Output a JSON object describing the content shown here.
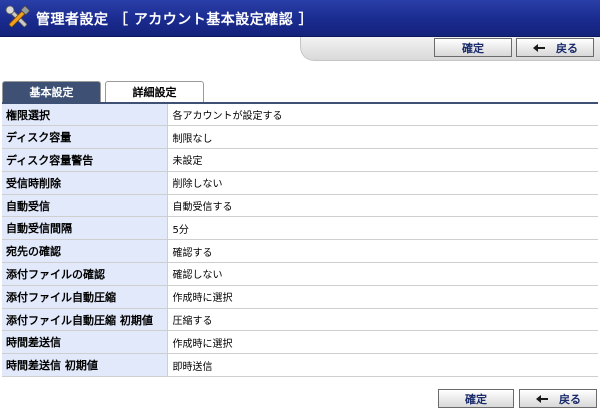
{
  "header": {
    "title": "管理者設定 ［ アカウント基本設定確認 ］",
    "icon": "tools-icon",
    "bar_color": "#1a2b8f"
  },
  "buttons": {
    "confirm": "確定",
    "back": "戻る",
    "back_icon": "back-arrow-icon"
  },
  "tabs": [
    {
      "label": "基本設定",
      "active": true
    },
    {
      "label": "詳細設定",
      "active": false
    }
  ],
  "settings": [
    {
      "label": "権限選択",
      "value": "各アカウントが設定する"
    },
    {
      "label": "ディスク容量",
      "value": "制限なし"
    },
    {
      "label": "ディスク容量警告",
      "value": "未設定"
    },
    {
      "label": "受信時削除",
      "value": "削除しない"
    },
    {
      "label": "自動受信",
      "value": "自動受信する"
    },
    {
      "label": "自動受信間隔",
      "value": "5分"
    },
    {
      "label": "宛先の確認",
      "value": "確認する"
    },
    {
      "label": "添付ファイルの確認",
      "value": "確認しない"
    },
    {
      "label": "添付ファイル自動圧縮",
      "value": "作成時に選択"
    },
    {
      "label": "添付ファイル自動圧縮 初期値",
      "value": "圧縮する"
    },
    {
      "label": "時間差送信",
      "value": "作成時に選択"
    },
    {
      "label": "時間差送信 初期値",
      "value": "即時送信"
    }
  ]
}
